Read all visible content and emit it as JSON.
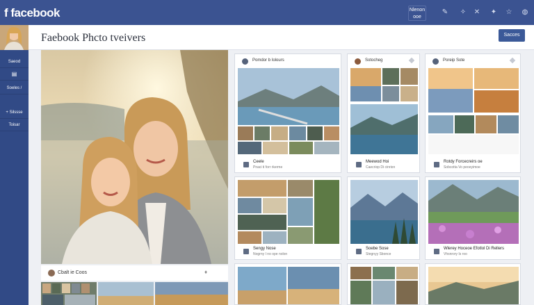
{
  "topbar": {
    "brand": "f facebook",
    "menu_label": "Nlenon ooe",
    "icons": [
      "edit-icon",
      "tool-icon",
      "close-icon",
      "sparkle-icon",
      "star-icon",
      "globe-icon"
    ]
  },
  "header": {
    "title": "Faebook Phcto tveivers",
    "button_label": "Sacces"
  },
  "sidebar": {
    "items": [
      {
        "label": "Saeod",
        "icon": "menu-icon"
      },
      {
        "label": "Soeles /"
      },
      {
        "label": "+ Silssse"
      },
      {
        "label": "Toisar"
      }
    ]
  },
  "hero": {
    "caption_name": "Cbalt ie Coos"
  },
  "cards": [
    {
      "head": "Pomdor b Iolours",
      "title": "Ceele",
      "sub": "Pnaci ti forr rkerme"
    },
    {
      "head": "Sotocheg",
      "title": "Meewod Hoi",
      "sub": "Caecriop Di cinrion"
    },
    {
      "head": "Poreip Sote",
      "title": "Rotdy Forcecreirs oe",
      "sub": "Sobcotta Vo peoeyimoe"
    },
    {
      "title": "Sengy Nose",
      "sub": "Nogrny I no ope nolon"
    },
    {
      "title": "Soebe Sose",
      "sub": "Stegnyy Sbonce"
    },
    {
      "title": "Wlerey Hoceoe Efotlol Di Rellers",
      "sub": "Vhsnrory Is roo"
    }
  ]
}
